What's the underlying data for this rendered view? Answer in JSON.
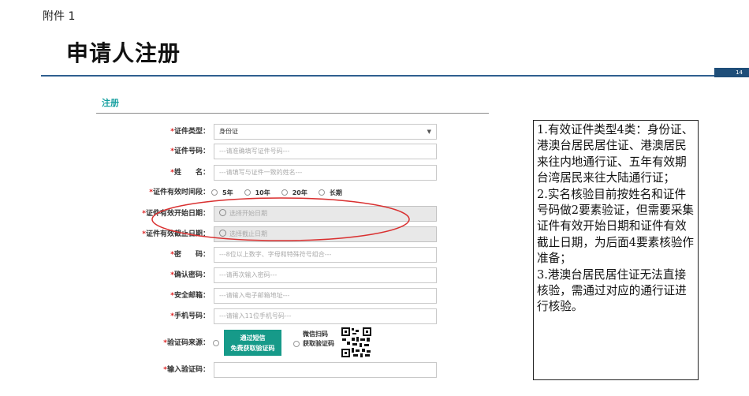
{
  "attachment_label": "附件 1",
  "page_title": "申请人注册",
  "page_number": "14",
  "form_title": "注册",
  "required_mark": "*",
  "fields": {
    "id_type": {
      "label": "证件类型：",
      "value": "身份证"
    },
    "id_number": {
      "label": "证件号码：",
      "placeholder": "---请准确填写证件号码---"
    },
    "name": {
      "label": "姓　　名：",
      "placeholder": "---请填写与证件一致的姓名---"
    },
    "validity": {
      "label": "证件有效时间段：",
      "options": [
        "5年",
        "10年",
        "20年",
        "长期"
      ]
    },
    "valid_start": {
      "label": "证件有效开始日期：",
      "placeholder": "选择开始日期"
    },
    "valid_end": {
      "label": "证件有效截止日期：",
      "placeholder": "选择截止日期"
    },
    "password": {
      "label": "密　　码：",
      "placeholder": "---8位以上数字、字母和特殊符号组合---"
    },
    "confirm_password": {
      "label": "确认密码：",
      "placeholder": "---请再次输入密码---"
    },
    "email": {
      "label": "安全邮箱：",
      "placeholder": "---请输入电子邮箱地址---"
    },
    "phone": {
      "label": "手机号码：",
      "placeholder": "---请输入11位手机号码---"
    },
    "code_source": {
      "label": "验证码来源：",
      "sms_button_line1": "通过短信",
      "sms_button_line2": "免费获取验证码",
      "wechat_line1": "微信扫码",
      "wechat_line2": "获取验证码"
    },
    "code": {
      "label": "输入验证码："
    }
  },
  "callout": [
    "1.有效证件类型4类：身份证、港澳台居民居住证、港澳居民来往内地通行证、五年有效期台湾居民来往大陆通行证；",
    "2.实名核验目前按姓名和证件号码做2要素验证，但需要采集证件有效开始日期和证件有效截止日期，为后面4要素核验作准备；",
    "3.港澳台居民居住证无法直接核验，需通过对应的通行证进行核验。"
  ],
  "colors": {
    "accent_teal": "#169a89",
    "title_teal": "#17a0a0",
    "rule_blue": "#2f5f8f",
    "required_red": "#d22222",
    "annotation_red": "#d93030"
  },
  "icons": {
    "caret": "caret-down-icon",
    "clock": "clock-icon",
    "qr": "qr-code-icon"
  }
}
